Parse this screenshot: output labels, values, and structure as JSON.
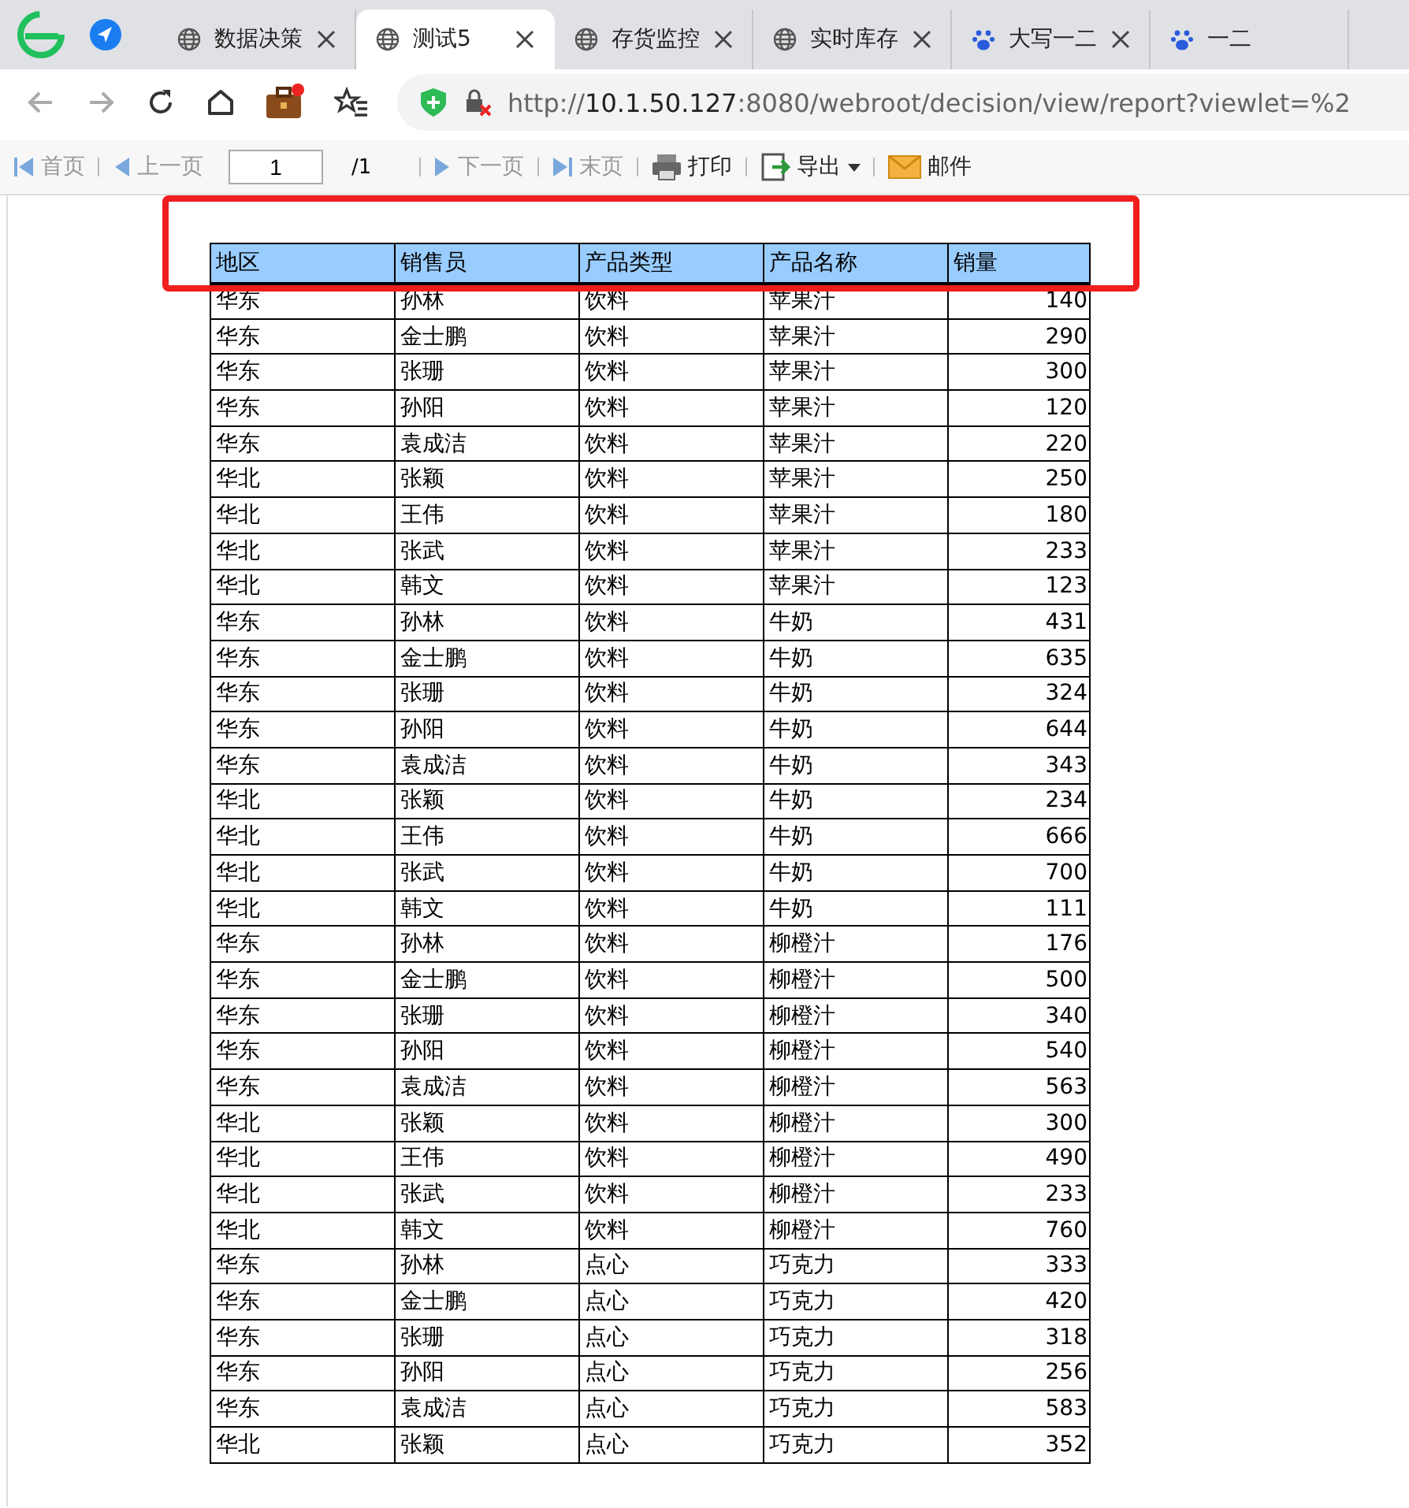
{
  "browser_tabs": [
    {
      "title": "数据决策",
      "selected": false,
      "closable": true
    },
    {
      "title": "测试5",
      "selected": true,
      "closable": true
    },
    {
      "title": "存货监控",
      "selected": false,
      "closable": true
    },
    {
      "title": "实时库存",
      "selected": false,
      "closable": true
    },
    {
      "title": "大写一二",
      "selected": false,
      "closable": true
    },
    {
      "title": "一二",
      "selected": false,
      "closable": false
    }
  ],
  "address_bar": {
    "url_scheme": "http://",
    "url_host": "10.1.50.127",
    "url_rest": ":8080/webroot/decision/view/report?viewlet=%2"
  },
  "report_toolbar": {
    "items": [
      {
        "kind": "nav",
        "label": "首页",
        "disabled": true
      },
      {
        "kind": "nav",
        "label": "上一页",
        "disabled": true
      },
      {
        "kind": "page",
        "value": "1",
        "total": "/1"
      },
      {
        "kind": "nav",
        "label": "下一页",
        "disabled": true
      },
      {
        "kind": "nav",
        "label": "末页",
        "disabled": true
      },
      {
        "kind": "action",
        "label": "打印",
        "disabled": false
      },
      {
        "kind": "menu",
        "label": "导出",
        "disabled": false
      },
      {
        "kind": "action",
        "label": "邮件",
        "disabled": false
      }
    ]
  },
  "table": {
    "columns": [
      "地区",
      "销售员",
      "产品类型",
      "产品名称",
      "销量"
    ],
    "rows": [
      [
        "华东",
        "孙林",
        "饮料",
        "苹果汁",
        "140"
      ],
      [
        "华东",
        "金士鹏",
        "饮料",
        "苹果汁",
        "290"
      ],
      [
        "华东",
        "张珊",
        "饮料",
        "苹果汁",
        "300"
      ],
      [
        "华东",
        "孙阳",
        "饮料",
        "苹果汁",
        "120"
      ],
      [
        "华东",
        "袁成洁",
        "饮料",
        "苹果汁",
        "220"
      ],
      [
        "华北",
        "张颖",
        "饮料",
        "苹果汁",
        "250"
      ],
      [
        "华北",
        "王伟",
        "饮料",
        "苹果汁",
        "180"
      ],
      [
        "华北",
        "张武",
        "饮料",
        "苹果汁",
        "233"
      ],
      [
        "华北",
        "韩文",
        "饮料",
        "苹果汁",
        "123"
      ],
      [
        "华东",
        "孙林",
        "饮料",
        "牛奶",
        "431"
      ],
      [
        "华东",
        "金士鹏",
        "饮料",
        "牛奶",
        "635"
      ],
      [
        "华东",
        "张珊",
        "饮料",
        "牛奶",
        "324"
      ],
      [
        "华东",
        "孙阳",
        "饮料",
        "牛奶",
        "644"
      ],
      [
        "华东",
        "袁成洁",
        "饮料",
        "牛奶",
        "343"
      ],
      [
        "华北",
        "张颖",
        "饮料",
        "牛奶",
        "234"
      ],
      [
        "华北",
        "王伟",
        "饮料",
        "牛奶",
        "666"
      ],
      [
        "华北",
        "张武",
        "饮料",
        "牛奶",
        "700"
      ],
      [
        "华北",
        "韩文",
        "饮料",
        "牛奶",
        "111"
      ],
      [
        "华东",
        "孙林",
        "饮料",
        "柳橙汁",
        "176"
      ],
      [
        "华东",
        "金士鹏",
        "饮料",
        "柳橙汁",
        "500"
      ],
      [
        "华东",
        "张珊",
        "饮料",
        "柳橙汁",
        "340"
      ],
      [
        "华东",
        "孙阳",
        "饮料",
        "柳橙汁",
        "540"
      ],
      [
        "华东",
        "袁成洁",
        "饮料",
        "柳橙汁",
        "563"
      ],
      [
        "华北",
        "张颖",
        "饮料",
        "柳橙汁",
        "300"
      ],
      [
        "华北",
        "王伟",
        "饮料",
        "柳橙汁",
        "490"
      ],
      [
        "华北",
        "张武",
        "饮料",
        "柳橙汁",
        "233"
      ],
      [
        "华北",
        "韩文",
        "饮料",
        "柳橙汁",
        "760"
      ],
      [
        "华东",
        "孙林",
        "点心",
        "巧克力",
        "333"
      ],
      [
        "华东",
        "金士鹏",
        "点心",
        "巧克力",
        "420"
      ],
      [
        "华东",
        "张珊",
        "点心",
        "巧克力",
        "318"
      ],
      [
        "华东",
        "孙阳",
        "点心",
        "巧克力",
        "256"
      ],
      [
        "华东",
        "袁成洁",
        "点心",
        "巧克力",
        "583"
      ],
      [
        "华北",
        "张颖",
        "点心",
        "巧克力",
        "352"
      ]
    ]
  },
  "annotation": {
    "highlight_header": true
  }
}
